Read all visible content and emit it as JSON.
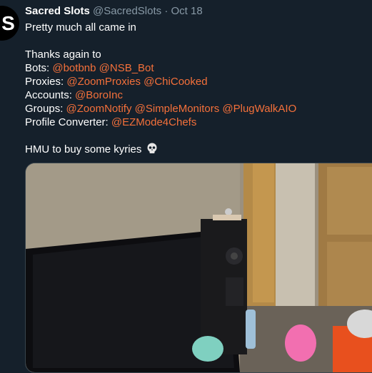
{
  "tweet": {
    "avatar_text": "S",
    "name": "Sacred Slots",
    "handle": "@SacredSlots",
    "separator": "·",
    "date": "Oct 18",
    "lines": [
      {
        "prefix": "Pretty much all came in",
        "mentions": []
      },
      {
        "prefix": "",
        "mentions": []
      },
      {
        "prefix": "Thanks again to",
        "mentions": []
      },
      {
        "prefix": "Bots: ",
        "mentions": [
          "@botbnb",
          "@NSB_Bot"
        ]
      },
      {
        "prefix": "Proxies: ",
        "mentions": [
          "@ZoomProxies",
          "@ChiCooked"
        ]
      },
      {
        "prefix": "Accounts: ",
        "mentions": [
          "@BoroInc"
        ]
      },
      {
        "prefix": "Groups: ",
        "mentions": [
          "@ZoomNotify",
          "@SimpleMonitors",
          "@PlugWalkAIO"
        ]
      },
      {
        "prefix": "Profile Converter: ",
        "mentions": [
          "@EZMode4Chefs"
        ]
      },
      {
        "prefix": "",
        "mentions": []
      },
      {
        "prefix": "HMU to buy some kyries",
        "mentions": [],
        "emoji": "skull"
      }
    ]
  },
  "colors": {
    "background": "#15202b",
    "mention": "#f4703a",
    "muted": "#8899a6"
  }
}
